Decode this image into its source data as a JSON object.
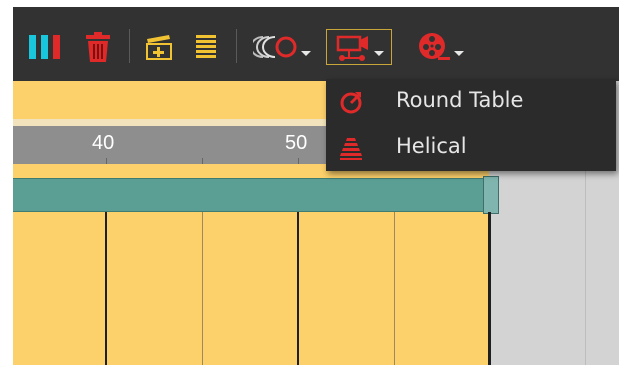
{
  "toolbar": {
    "buttons": [
      {
        "name": "columns",
        "icon": "columns-icon"
      },
      {
        "name": "delete",
        "icon": "trash-icon"
      },
      {
        "name": "clapper-add",
        "icon": "clapper-add-icon"
      },
      {
        "name": "layers",
        "icon": "layers-icon"
      },
      {
        "name": "echo",
        "icon": "echo-circle-icon"
      },
      {
        "name": "camera-path",
        "icon": "camera-path-icon"
      },
      {
        "name": "film-reel",
        "icon": "film-reel-icon"
      }
    ]
  },
  "ruler": {
    "labels": [
      "40",
      "50"
    ]
  },
  "menu": {
    "items": [
      {
        "label": "Round Table",
        "icon": "round-table-icon"
      },
      {
        "label": "Helical",
        "icon": "helical-icon"
      }
    ]
  },
  "colors": {
    "toolbar_bg": "#323232",
    "accent_cyan": "#19c7dc",
    "accent_red": "#e02a2a",
    "timeline_yellow": "#fcd06a",
    "clip_teal": "#5a9e94",
    "ruler_grey": "#8e8e8e",
    "menu_bg": "#2b2b2b",
    "active_border": "#c9a63a"
  }
}
